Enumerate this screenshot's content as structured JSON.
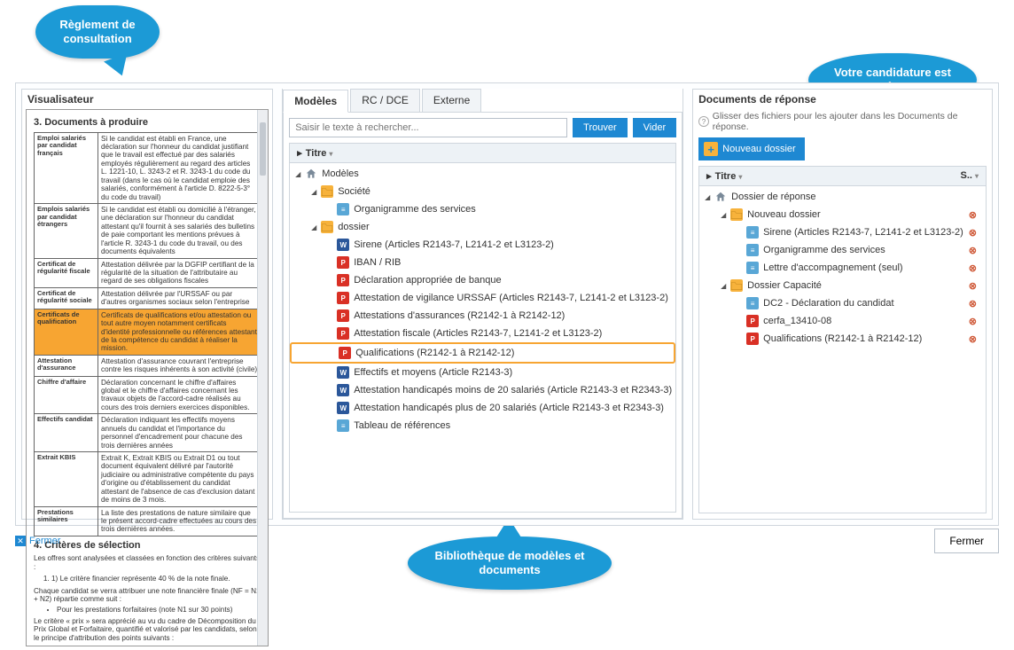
{
  "callouts": {
    "c1": "Règlement de consultation",
    "c2": "Votre candidature est prête !",
    "c3": "Bibliothèque de modèles et documents"
  },
  "viewer": {
    "title": "Visualisateur",
    "section1": "3. Documents à produire",
    "rows": [
      {
        "k": "Emploi salariés par candidat français",
        "v": "Si le candidat est établi en France, une déclaration sur l'honneur du candidat justifiant que le travail est effectué par des salariés employés régulièrement au regard des articles L. 1221-10, L. 3243-2 et R. 3243-1 du code du travail (dans le cas où le candidat emploie des salariés, conformément à l'article D. 8222-5-3° du code du travail)",
        "hl": false
      },
      {
        "k": "Emplois salariés par candidat étrangers",
        "v": "Si le candidat est établi ou domicilié à l'étranger, une déclaration sur l'honneur du candidat attestant qu'il fournit à ses salariés des bulletins de paie comportant les mentions prévues à l'article R. 3243-1 du code du travail, ou des documents équivalents",
        "hl": false
      },
      {
        "k": "Certificat de régularité fiscale",
        "v": "Attestation délivrée par la DGFIP certifiant de la régularité de la situation de l'attributaire au regard de ses obligations fiscales",
        "hl": false
      },
      {
        "k": "Certificat de régularité sociale",
        "v": "Attestation délivrée par l'URSSAF ou par d'autres organismes sociaux selon l'entreprise",
        "hl": false
      },
      {
        "k": "Certificats de qualification",
        "v": "Certificats de qualifications et/ou attestation ou tout autre moyen notamment certificats d'identité professionnelle ou références attestant de la compétence du candidat à réaliser la mission.",
        "hl": true
      },
      {
        "k": "Attestation d'assurance",
        "v": "Attestation d'assurance couvrant l'entreprise contre les risques inhérents à son activité (civile)",
        "hl": false
      },
      {
        "k": "Chiffre d'affaire",
        "v": "Déclaration concernant le chiffre d'affaires global et le chiffre d'affaires concernant les travaux objets de l'accord-cadre réalisés au cours des trois derniers exercices disponibles.",
        "hl": false
      },
      {
        "k": "Effectifs candidat",
        "v": "Déclaration indiquant les effectifs moyens annuels du candidat et l'importance du personnel d'encadrement pour chacune des trois dernières années",
        "hl": false
      },
      {
        "k": "Extrait KBIS",
        "v": "Extrait K, Extrait KBIS ou Extrait D1 ou tout document équivalent délivré par l'autorité judiciaire ou administrative compétente du pays d'origine ou d'établissement du candidat attestant de l'absence de cas d'exclusion datant de moins de 3 mois.",
        "hl": false
      },
      {
        "k": "Prestations similaires",
        "v": "La liste des prestations de nature similaire que le présent accord-cadre effectuées au cours des trois dernières années.",
        "hl": false
      }
    ],
    "section2": "4. Critères de sélection",
    "p1": "Les offres sont analysées et classées en fonction des critères suivants :",
    "li1": "Le critère financier représente 40 % de la note finale.",
    "p2": "Chaque candidat se verra attribuer une note financière finale (NF = N1 + N2) répartie comme suit :",
    "li2": "Pour les prestations forfaitaires (note N1 sur 30 points)",
    "p3": "Le critère « prix » sera apprécié au vu du cadre de Décomposition du Prix Global et Forfaitaire, quantifié et valorisé par les candidats, selon le principe d'attribution des points suivants :"
  },
  "mid": {
    "tabs": [
      "Modèles",
      "RC / DCE",
      "Externe"
    ],
    "search_placeholder": "Saisir le texte à rechercher...",
    "find": "Trouver",
    "clear": "Vider",
    "th": "Titre",
    "root": "Modèles",
    "folders": {
      "societe": "Société",
      "org": "Organigramme des services",
      "dossier": "dossier"
    },
    "items": [
      {
        "ico": "word",
        "t": "Sirene (Articles R2143-7, L2141-2 et L3123-2)"
      },
      {
        "ico": "pdf",
        "t": "IBAN / RIB"
      },
      {
        "ico": "pdf",
        "t": "Déclaration appropriée de banque"
      },
      {
        "ico": "pdf",
        "t": "Attestation de vigilance URSSAF (Articles R2143-7, L2141-2 et L3123-2)"
      },
      {
        "ico": "pdf",
        "t": "Attestations d'assurances (R2142-1 à R2142-12)"
      },
      {
        "ico": "pdf",
        "t": "Attestation fiscale (Articles R2143-7, L2141-2 et L3123-2)"
      },
      {
        "ico": "pdf",
        "t": "Qualifications (R2142-1 à R2142-12)",
        "hl": true
      },
      {
        "ico": "word",
        "t": "Effectifs et moyens (Article R2143-3)"
      },
      {
        "ico": "word",
        "t": "Attestation handicapés moins de 20 salariés (Article R2143-3 et R2343-3)"
      },
      {
        "ico": "word",
        "t": "Attestation handicapés plus de 20 salariés (Article R2143-3 et R2343-3)"
      },
      {
        "ico": "doc",
        "t": "Tableau de références"
      }
    ]
  },
  "right": {
    "title": "Documents de réponse",
    "hint": "Glisser des fichiers pour les ajouter dans les Documents de réponse.",
    "newfolder": "Nouveau dossier",
    "th1": "Titre",
    "th2": "S..",
    "root": "Dossier de réponse",
    "f1": "Nouveau dossier",
    "f2": "Dossier Capacité",
    "g1": [
      {
        "ico": "doc",
        "t": "Sirene (Articles R2143-7, L2141-2 et L3123-2)"
      },
      {
        "ico": "doc",
        "t": "Organigramme des services"
      },
      {
        "ico": "doc",
        "t": "Lettre d'accompagnement (seul)"
      }
    ],
    "g2": [
      {
        "ico": "doc",
        "t": "DC2 - Déclaration du candidat"
      },
      {
        "ico": "pdf",
        "t": "cerfa_13410-08"
      },
      {
        "ico": "pdf",
        "t": "Qualifications (R2142-1 à R2142-12)"
      }
    ]
  },
  "footer": {
    "close": "Fermer"
  }
}
